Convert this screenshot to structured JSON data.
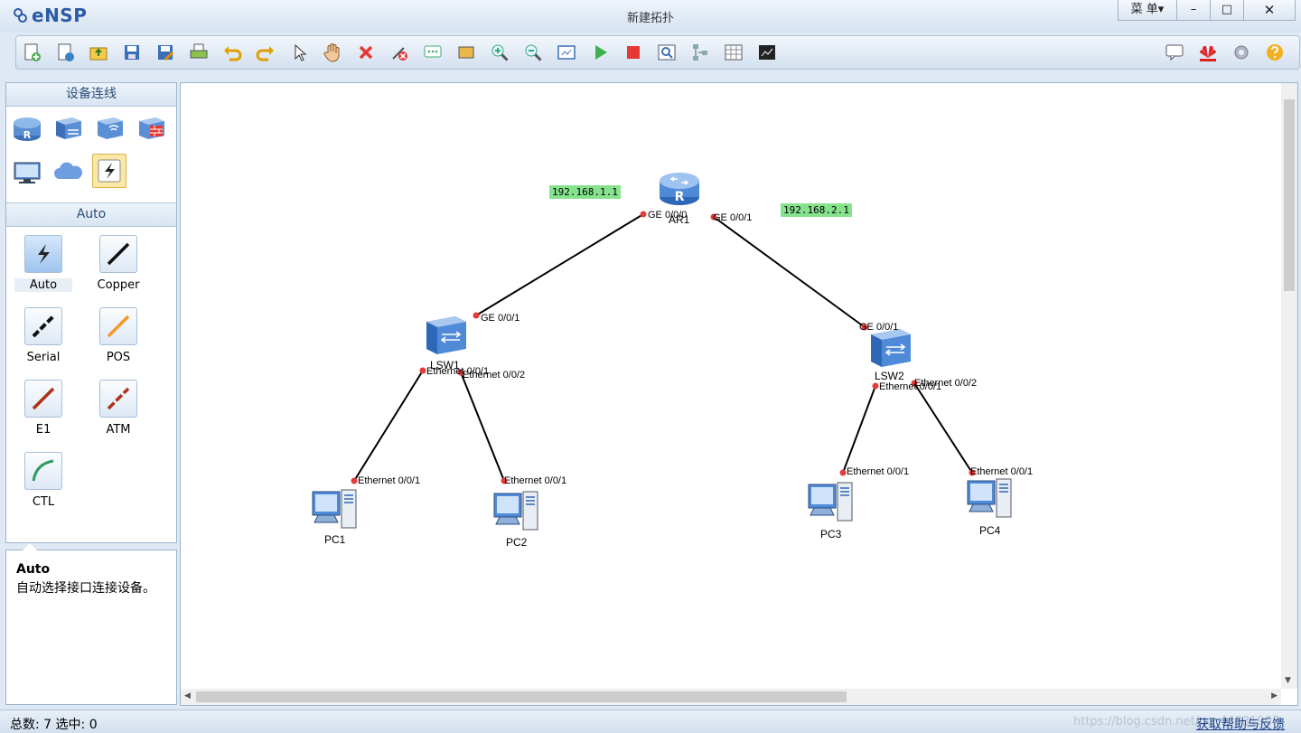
{
  "app": {
    "logo": "eNSP",
    "title": "新建拓扑",
    "menu_label": "菜 单▾"
  },
  "window_controls": {
    "minimize": "–",
    "maximize": "□",
    "close": "✕"
  },
  "toolbar_icons": [
    "new-topology-icon",
    "new-task-icon",
    "open-icon",
    "save-icon",
    "save-as-icon",
    "print-icon",
    "undo-icon",
    "redo-icon",
    "select-icon",
    "pan-hand-icon",
    "delete-icon",
    "delete-link-icon",
    "text-note-icon",
    "rectangle-icon",
    "zoom-in-icon",
    "zoom-out-icon",
    "fit-view-icon",
    "start-device-icon",
    "stop-device-icon",
    "capture-icon",
    "topology-icon",
    "grid-icon",
    "console-icon",
    "chat-icon",
    "huawei-icon",
    "settings-icon",
    "help-icon"
  ],
  "device_panel": {
    "title": "设备连线",
    "category_title": "Auto"
  },
  "link_types": [
    "Auto",
    "Copper",
    "Serial",
    "POS",
    "E1",
    "ATM",
    "CTL"
  ],
  "description": {
    "title": "Auto",
    "text": "自动选择接口连接设备。"
  },
  "topology": {
    "ip_labels": [
      "192.168.1.1",
      "192.168.2.1"
    ],
    "nodes": {
      "ar1": "AR1",
      "lsw1": "LSW1",
      "lsw2": "LSW2",
      "pc1": "PC1",
      "pc2": "PC2",
      "pc3": "PC3",
      "pc4": "PC4"
    },
    "ports": {
      "ar1_ge000": "GE 0/0/0",
      "ar1_ge001": "GE 0/0/1",
      "lsw1_ge001": "GE 0/0/1",
      "lsw1_e001": "Ethernet 0/0/1",
      "lsw1_e002": "Ethernet 0/0/2",
      "lsw2_ge001": "GE 0/0/1",
      "lsw2_e001": "Ethernet 0/0/1",
      "lsw2_e002": "Ethernet 0/0/2",
      "pc1_e001": "Ethernet 0/0/1",
      "pc2_e001": "Ethernet 0/0/1",
      "pc3_e001": "Ethernet 0/0/1",
      "pc4_e001": "Ethernet 0/0/1"
    }
  },
  "status": {
    "summary": "总数:  7  选中:  0",
    "watermark": "https://blog.csdn.net/qq_44831907",
    "help_link": "获取帮助与反馈"
  },
  "colors": {
    "ip_label_bg": "#86e38d",
    "port_dot": "#e53b3b",
    "accent": "#2b5aa6"
  }
}
